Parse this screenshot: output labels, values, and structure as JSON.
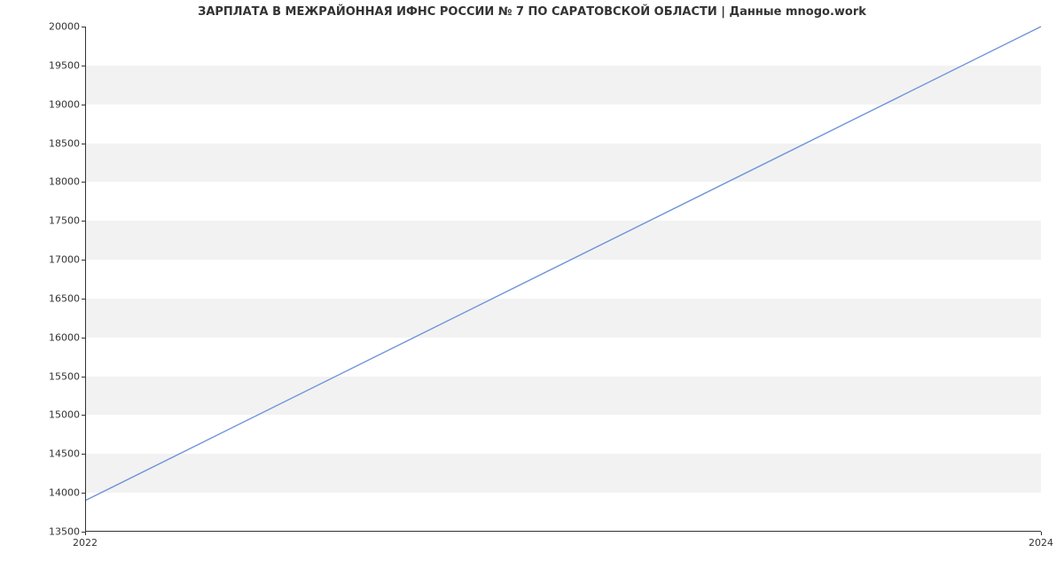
{
  "chart_data": {
    "type": "line",
    "title": "ЗАРПЛАТА В МЕЖРАЙОННАЯ ИФНС РОССИИ № 7 ПО САРАТОВСКОЙ ОБЛАСТИ | Данные mnogo.work",
    "xlabel": "",
    "ylabel": "",
    "x": [
      2022,
      2024
    ],
    "values": [
      13900,
      20000
    ],
    "xlim": [
      2022,
      2024
    ],
    "ylim": [
      13500,
      20000
    ],
    "xticks": [
      2022,
      2024
    ],
    "yticks": [
      13500,
      14000,
      14500,
      15000,
      15500,
      16000,
      16500,
      17000,
      17500,
      18000,
      18500,
      19000,
      19500,
      20000
    ],
    "grid_bands": true,
    "line_color": "#6f94d8"
  }
}
